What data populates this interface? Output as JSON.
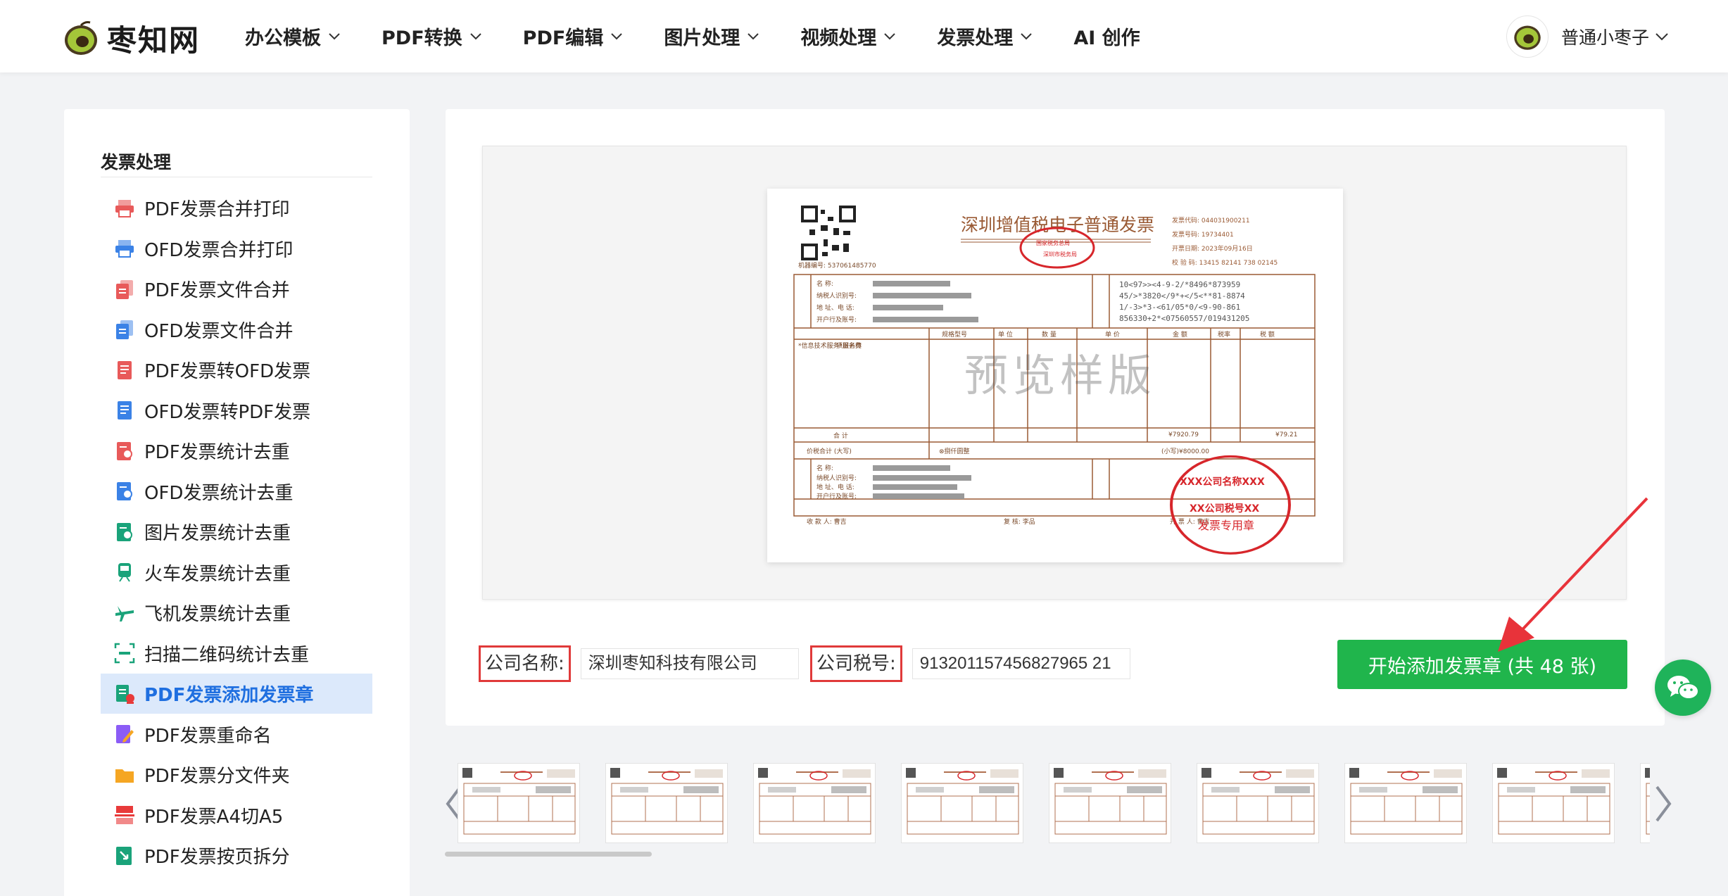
{
  "header": {
    "logo_text": "枣知网",
    "nav": [
      {
        "label": "办公模板",
        "has_dropdown": true
      },
      {
        "label": "PDF转换",
        "has_dropdown": true
      },
      {
        "label": "PDF编辑",
        "has_dropdown": true
      },
      {
        "label": "图片处理",
        "has_dropdown": true
      },
      {
        "label": "视频处理",
        "has_dropdown": true
      },
      {
        "label": "发票处理",
        "has_dropdown": true
      },
      {
        "label": "AI 创作",
        "has_dropdown": false
      }
    ],
    "user_name": "普通小枣子"
  },
  "sidebar": {
    "title": "发票处理",
    "items": [
      {
        "label": "PDF发票合并打印",
        "icon": "printer-icon",
        "color": "#e85a5a"
      },
      {
        "label": "OFD发票合并打印",
        "icon": "printer-icon",
        "color": "#3b82e6"
      },
      {
        "label": "PDF发票文件合并",
        "icon": "merge-doc-icon",
        "color": "#e85a5a"
      },
      {
        "label": "OFD发票文件合并",
        "icon": "merge-doc-icon",
        "color": "#3b82e6"
      },
      {
        "label": "PDF发票转OFD发票",
        "icon": "convert-icon",
        "color": "#e85a5a"
      },
      {
        "label": "OFD发票转PDF发票",
        "icon": "convert-icon",
        "color": "#3b82e6"
      },
      {
        "label": "PDF发票统计去重",
        "icon": "stats-icon",
        "color": "#e85a5a"
      },
      {
        "label": "OFD发票统计去重",
        "icon": "stats-icon",
        "color": "#3b82e6"
      },
      {
        "label": "图片发票统计去重",
        "icon": "image-stats-icon",
        "color": "#1aa37a"
      },
      {
        "label": "火车发票统计去重",
        "icon": "train-icon",
        "color": "#1aa37a"
      },
      {
        "label": "飞机发票统计去重",
        "icon": "plane-icon",
        "color": "#1aa37a"
      },
      {
        "label": "扫描二维码统计去重",
        "icon": "qr-scan-icon",
        "color": "#1aa37a"
      },
      {
        "label": "PDF发票添加发票章",
        "icon": "stamp-icon",
        "color": "#1aa37a",
        "active": true
      },
      {
        "label": "PDF发票重命名",
        "icon": "rename-icon",
        "color": "#8b5cf6"
      },
      {
        "label": "PDF发票分文件夹",
        "icon": "folder-icon",
        "color": "#f5a623"
      },
      {
        "label": "PDF发票A4切A5",
        "icon": "cut-icon",
        "color": "#e83a3a"
      },
      {
        "label": "PDF发票按页拆分",
        "icon": "split-icon",
        "color": "#1aa37a"
      }
    ]
  },
  "preview": {
    "watermark": "预览样版",
    "invoice_title": "深圳增值税电子普通发票",
    "stamp_top": "XXX公司名称XXX",
    "stamp_mid": "XX公司税号XX",
    "stamp_bottom": "发票专用章",
    "tax_stamp": "国家税务总局",
    "total_small": "(小写)¥8000.00",
    "buyer_label_1": "名  称:",
    "seller_label_1": "名  称:"
  },
  "form": {
    "company_name_label": "公司名称:",
    "company_name_value": "深圳枣知科技有限公司",
    "tax_id_label": "公司税号:",
    "tax_id_value": "913201157456827965 21",
    "start_button": "开始添加发票章 (共 48 张)"
  },
  "thumbnails": {
    "count_visible": 9
  },
  "colors": {
    "brand_green": "#20b54c",
    "active_blue": "#1f6fe0",
    "highlight_red": "#e03a3a",
    "invoice_brown": "#9a5a34"
  }
}
